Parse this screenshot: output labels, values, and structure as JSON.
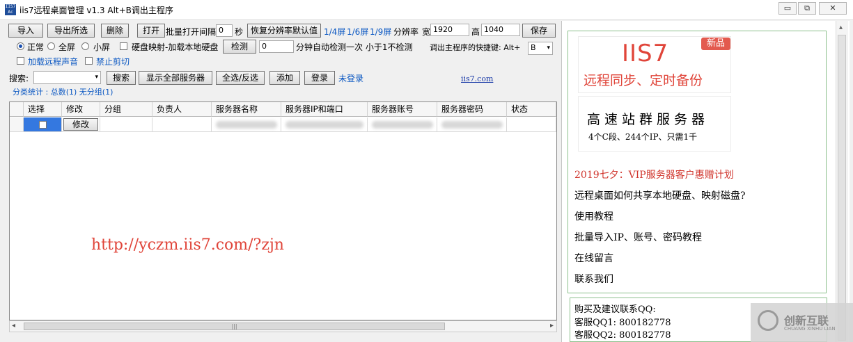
{
  "window": {
    "title": "iis7远程桌面管理 v1.3 Alt+B调出主程序",
    "icon_text": "IIS7 Ac",
    "min": "▭",
    "restore": "⧉",
    "close": "✕"
  },
  "toolbar": {
    "import": "导入",
    "export_selected": "导出所选",
    "delete": "删除",
    "open": "打开",
    "batch_interval_label": "批量打开间隔",
    "interval_value": "0",
    "seconds": "秒",
    "restore_resolution": "恢复分辨率默认值",
    "screen_1_4": "1/4屏",
    "screen_1_6": "1/6屏",
    "screen_1_9": "1/9屏",
    "resolution_label": "分辨率",
    "width_label": "宽",
    "width_value": "1920",
    "height_label": "高",
    "height_value": "1040",
    "save": "保存"
  },
  "options": {
    "normal": "正常",
    "fullscreen": "全屏",
    "smallscreen": "小屏",
    "disk_map": "硬盘映射-加载本地硬盘",
    "detect": "检测",
    "detect_value": "0",
    "detect_note": "分钟自动检测一次 小于1不检测",
    "hotkey_label": "调出主程序的快捷键: Alt+",
    "hotkey_value": "B",
    "remote_sound": "加载远程声音",
    "forbid_clipboard": "禁止剪切"
  },
  "search": {
    "label": "搜索:",
    "search_btn": "搜索",
    "show_all": "显示全部服务器",
    "select_toggle": "全选/反选",
    "add": "添加",
    "login": "登录",
    "not_logged": "未登录",
    "site": "iis7.com"
  },
  "stats": {
    "text": "分类统计 : 总数(1) 无分组(1)"
  },
  "grid": {
    "columns": [
      "选择",
      "修改",
      "分组",
      "负责人",
      "服务器名称",
      "服务器IP和端口",
      "服务器账号",
      "服务器密码",
      "状态"
    ],
    "row_edit": "修改"
  },
  "watermark_url": "http://yczm.iis7.com/?zjn",
  "scroll": {
    "grip": "|||",
    "left": "◂",
    "right": "▸",
    "up": "▴",
    "down": "▾"
  },
  "ads": {
    "logo": "IIS7",
    "tag": "新品",
    "slogan": "远程同步、定时备份",
    "cluster_title": "高速站群服务器",
    "cluster_sub": "4个C段、244个IP、只需1千"
  },
  "links": [
    {
      "text": "2019七夕：VIP服务器客户惠赠计划",
      "color": "#d0342c"
    },
    {
      "text": "远程桌面如何共享本地硬盘、映射磁盘?",
      "color": "#000000"
    },
    {
      "text": "使用教程",
      "color": "#000000"
    },
    {
      "text": "批量导入IP、账号、密码教程",
      "color": "#000000"
    },
    {
      "text": "在线留言",
      "color": "#000000"
    },
    {
      "text": "联系我们",
      "color": "#000000"
    }
  ],
  "contact": {
    "title": "购买及建议联系QQ:",
    "qq1": "客服QQ1: 800182778",
    "qq2": "客服QQ2: 800182778"
  },
  "brand_watermark": {
    "text": "创新互联",
    "sub": "CHUANG XINHU LIAN"
  },
  "colors": {
    "accent_red": "#d0342c",
    "link_blue": "#0a57c2",
    "panel_border": "#8bbf8b"
  }
}
